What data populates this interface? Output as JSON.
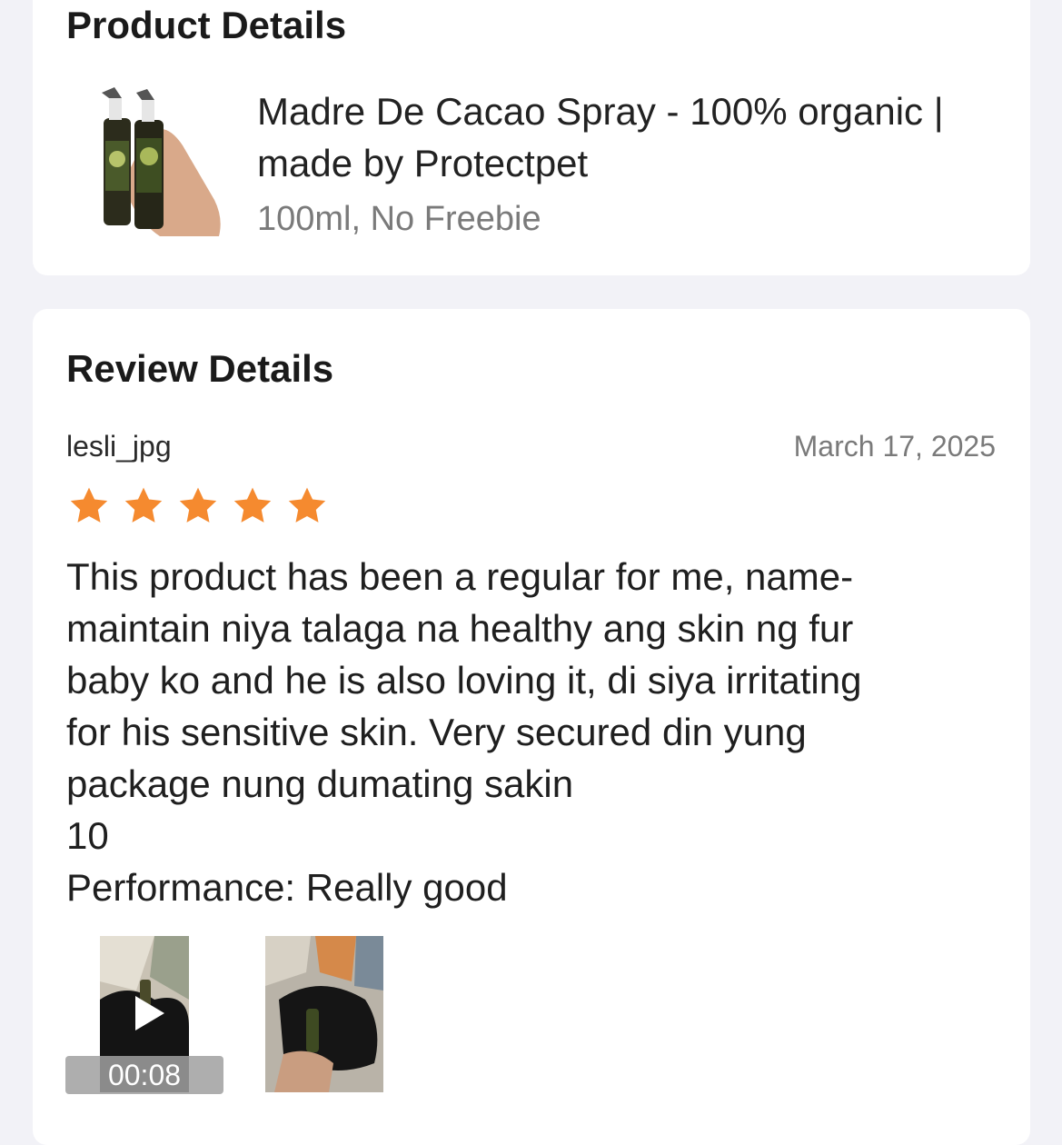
{
  "product_section": {
    "title": "Product Details",
    "product_name": "Madre De Cacao Spray - 100% organic | made by Protectpet",
    "variant": "100ml, No Freebie"
  },
  "review_section": {
    "title": "Review Details",
    "reviewer": "lesli_jpg",
    "date": "March 17, 2025",
    "rating": 5,
    "body_lines": [
      "This product has been a regular for me, name-",
      "maintain niya talaga na healthy ang skin ng fur",
      "baby ko and he is also loving it, di siya irritating",
      "for his sensitive skin. Very secured din yung",
      "package nung dumating sakin",
      "10",
      "Performance: Really good"
    ],
    "media": {
      "video_duration": "00:08"
    }
  },
  "colors": {
    "star": "#f58a2f",
    "page_background": "#f2f2f7",
    "muted_text": "#7a7a7a"
  },
  "icons": [
    "star-icon",
    "play-icon"
  ]
}
